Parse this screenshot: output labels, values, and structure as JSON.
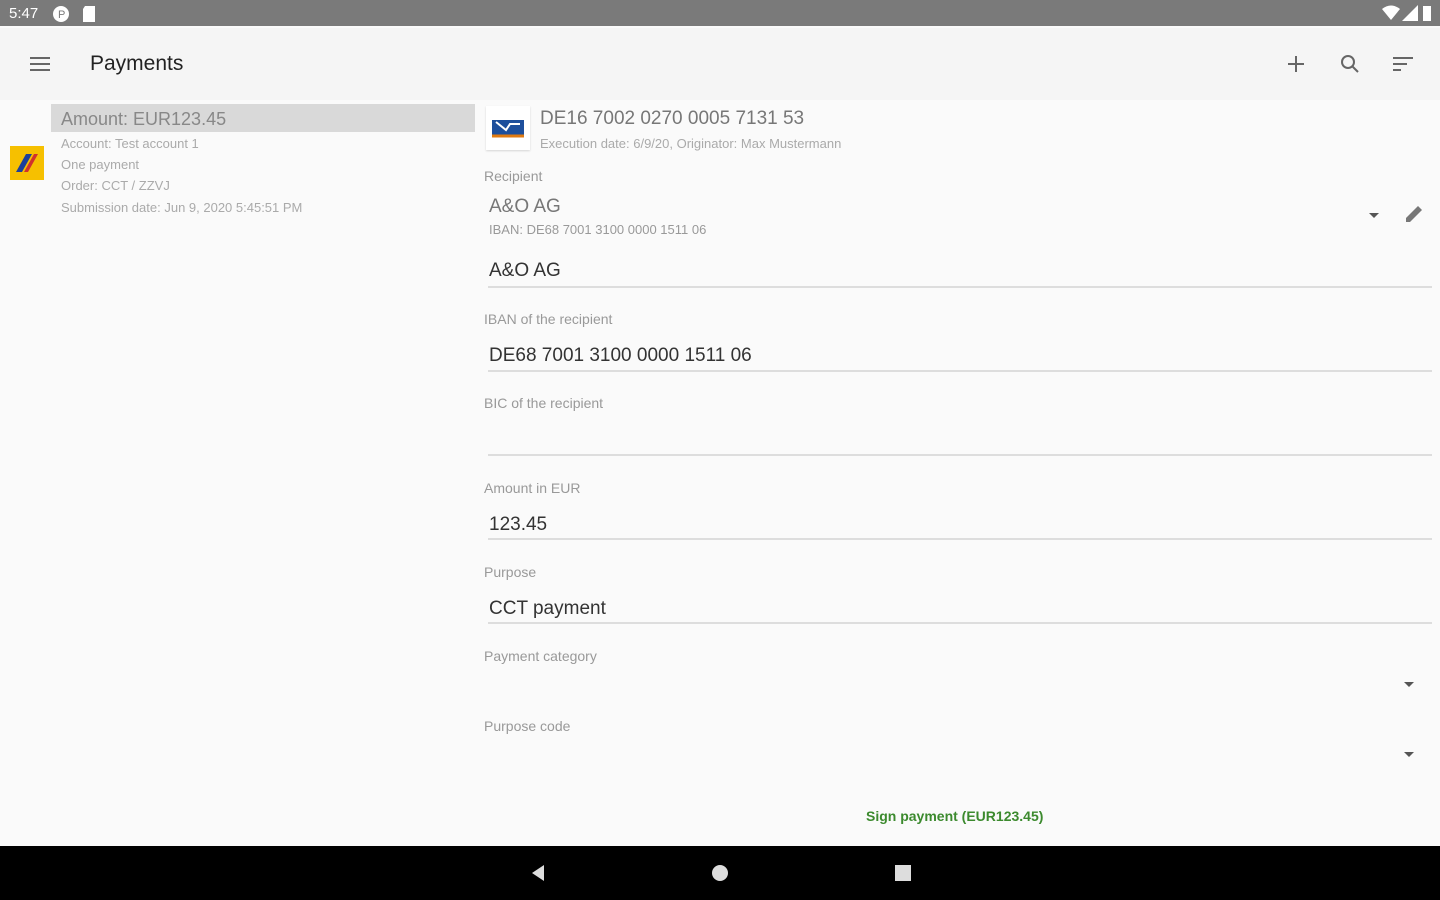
{
  "status_bar": {
    "time": "5:47"
  },
  "app_bar": {
    "title": "Payments",
    "menu_icon": "hamburger-menu-icon",
    "add_icon": "plus-icon",
    "search_icon": "search-icon",
    "sort_icon": "sort-icon"
  },
  "payment_list": [
    {
      "amount": "Amount: EUR123.45",
      "account": "Account: Test account 1",
      "type": "One payment",
      "order": "Order: CCT / ZZVJ",
      "submission": "Submission date: Jun 9, 2020 5:45:51 PM"
    }
  ],
  "detail": {
    "account_iban": "DE16 7002 0270 0005 7131 53",
    "execution": "Execution date: 6/9/20, Originator: Max Mustermann",
    "recipient_label": "Recipient",
    "recipient_name": "A&O AG",
    "recipient_iban": "IBAN: DE68 7001 3100 0000 1511 06",
    "name_value": "A&O AG",
    "iban_label": "IBAN of the recipient",
    "iban_value": "DE68 7001 3100 0000 1511 06",
    "bic_label": "BIC of the recipient",
    "bic_value": "",
    "amount_label": "Amount in EUR",
    "amount_value": "123.45",
    "purpose_label": "Purpose",
    "purpose_value": "CCT payment",
    "category_label": "Payment category",
    "purpose_code_label": "Purpose code",
    "sign_button": "Sign payment (EUR123.45)"
  },
  "colors": {
    "accent_green": "#3c8a2e",
    "status_bar": "#7a7a7a",
    "highlight": "#d9d9d9"
  }
}
